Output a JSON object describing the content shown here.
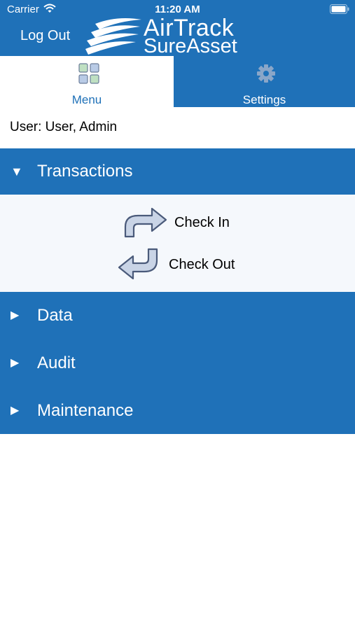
{
  "status_bar": {
    "carrier": "Carrier",
    "time": "11:20 AM"
  },
  "header": {
    "logout_label": "Log Out",
    "logo_line1": "AirTrack",
    "logo_line2": "SureAsset",
    "color": "#1f71b8"
  },
  "tabs": [
    {
      "label": "Menu",
      "icon": "grid-icon",
      "active": true
    },
    {
      "label": "Settings",
      "icon": "gear-icon",
      "active": false
    }
  ],
  "user_text": "User: User, Admin",
  "sections": {
    "transactions": {
      "arrow": "▼",
      "title": "Transactions",
      "actions": [
        {
          "label": "Check In",
          "icon": "redo-arrow-icon"
        },
        {
          "label": "Check Out",
          "icon": "undo-arrow-icon"
        }
      ]
    },
    "collapsed": [
      {
        "arrow": "▶",
        "title": "Data"
      },
      {
        "arrow": "▶",
        "title": "Audit"
      },
      {
        "arrow": "▶",
        "title": "Maintenance"
      }
    ]
  }
}
